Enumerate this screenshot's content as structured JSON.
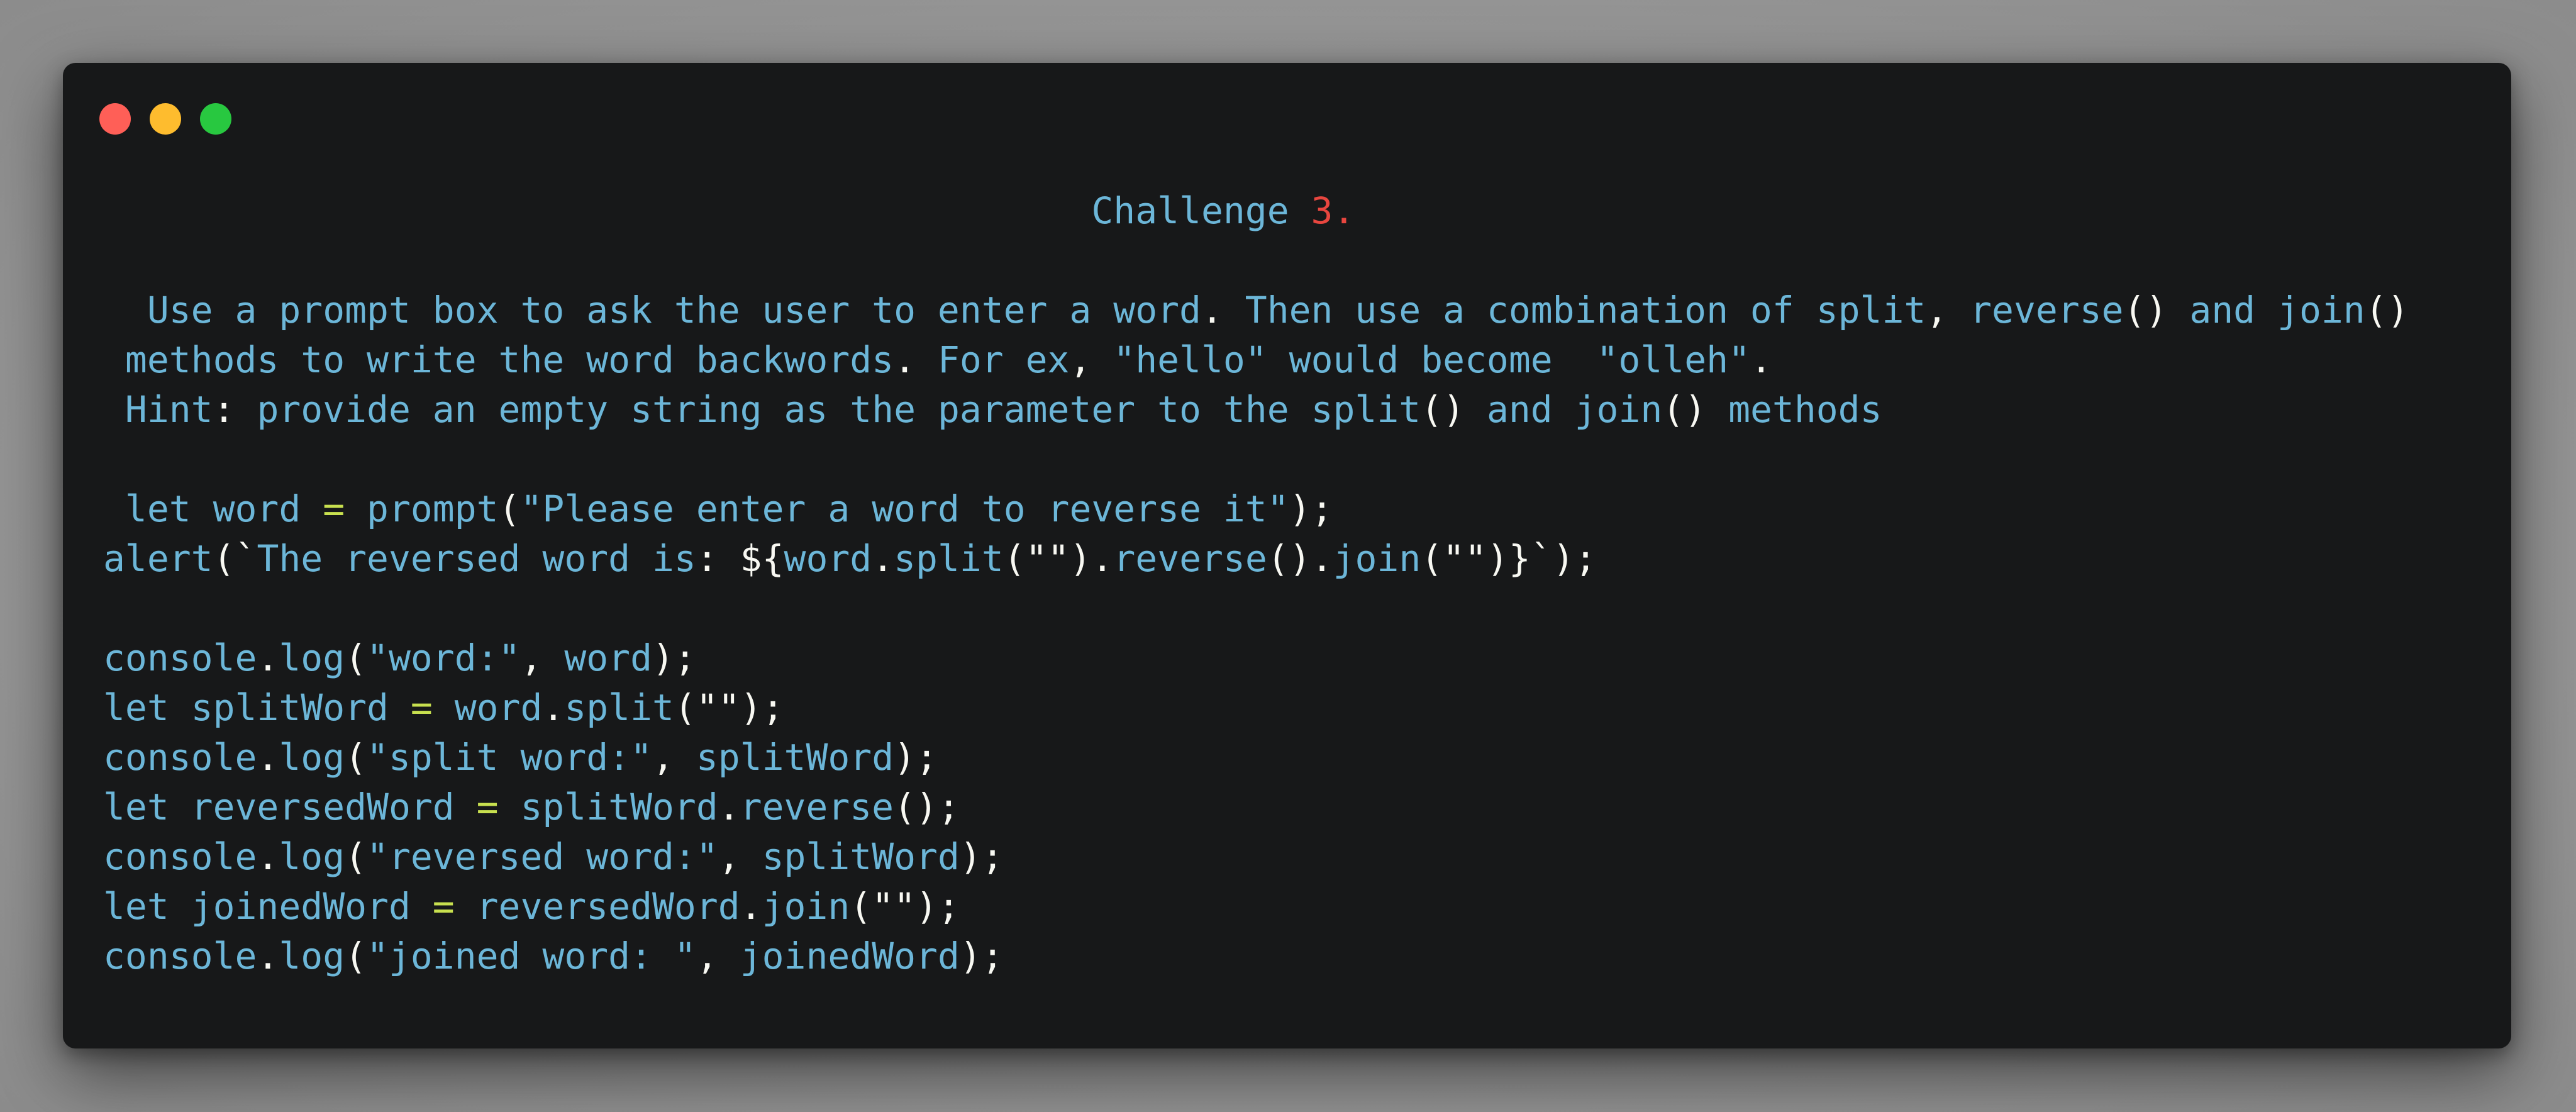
{
  "window": {
    "controls": [
      {
        "name": "close",
        "color": "#ff5f57"
      },
      {
        "name": "minimize",
        "color": "#febc2e"
      },
      {
        "name": "maximize",
        "color": "#28c840"
      }
    ]
  },
  "colors": {
    "background": "#171819",
    "text": "#6cb6d8",
    "number": "#e8463f",
    "punctuation": "#f8f8f2",
    "operator": "#c8e04f"
  },
  "code": {
    "lines": [
      [
        {
          "t": "                                             Challenge ",
          "c": "c"
        },
        {
          "t": "3.",
          "c": "n"
        }
      ],
      [],
      [
        {
          "t": "  Use a prompt box to ask the user to enter a word",
          "c": "c"
        },
        {
          "t": ". ",
          "c": "p"
        },
        {
          "t": "Then use a combination of split",
          "c": "c"
        },
        {
          "t": ", ",
          "c": "p"
        },
        {
          "t": "reverse",
          "c": "c"
        },
        {
          "t": "() ",
          "c": "p"
        },
        {
          "t": "and join",
          "c": "c"
        },
        {
          "t": "()",
          "c": "p"
        }
      ],
      [
        {
          "t": " methods to write the word backwords",
          "c": "c"
        },
        {
          "t": ". ",
          "c": "p"
        },
        {
          "t": "For ex",
          "c": "c"
        },
        {
          "t": ", ",
          "c": "p"
        },
        {
          "t": "\"hello\" would become  \"olleh\"",
          "c": "c"
        },
        {
          "t": ".",
          "c": "p"
        }
      ],
      [
        {
          "t": " Hint",
          "c": "c"
        },
        {
          "t": ": ",
          "c": "p"
        },
        {
          "t": "provide an empty string as the parameter to the split",
          "c": "c"
        },
        {
          "t": "() ",
          "c": "p"
        },
        {
          "t": "and join",
          "c": "c"
        },
        {
          "t": "() ",
          "c": "p"
        },
        {
          "t": "methods",
          "c": "c"
        }
      ],
      [],
      [
        {
          "t": " let word ",
          "c": "k"
        },
        {
          "t": "= ",
          "c": "o"
        },
        {
          "t": "prompt",
          "c": "c"
        },
        {
          "t": "(",
          "c": "p"
        },
        {
          "t": "\"Please enter a word to reverse it\"",
          "c": "s"
        },
        {
          "t": ");",
          "c": "p"
        }
      ],
      [
        {
          "t": "alert",
          "c": "c"
        },
        {
          "t": "(`",
          "c": "p"
        },
        {
          "t": "The reversed word is",
          "c": "s"
        },
        {
          "t": ": ${",
          "c": "p"
        },
        {
          "t": "word",
          "c": "c"
        },
        {
          "t": ".",
          "c": "p"
        },
        {
          "t": "split",
          "c": "c"
        },
        {
          "t": "(\"\").",
          "c": "p"
        },
        {
          "t": "reverse",
          "c": "c"
        },
        {
          "t": "().",
          "c": "p"
        },
        {
          "t": "join",
          "c": "c"
        },
        {
          "t": "(\"\")}`);",
          "c": "p"
        }
      ],
      [],
      [
        {
          "t": "console",
          "c": "c"
        },
        {
          "t": ".",
          "c": "p"
        },
        {
          "t": "log",
          "c": "c"
        },
        {
          "t": "(",
          "c": "p"
        },
        {
          "t": "\"word:\"",
          "c": "s"
        },
        {
          "t": ", ",
          "c": "p"
        },
        {
          "t": "word",
          "c": "c"
        },
        {
          "t": ");",
          "c": "p"
        }
      ],
      [
        {
          "t": "let splitWord ",
          "c": "k"
        },
        {
          "t": "= ",
          "c": "o"
        },
        {
          "t": "word",
          "c": "c"
        },
        {
          "t": ".",
          "c": "p"
        },
        {
          "t": "split",
          "c": "c"
        },
        {
          "t": "(\"\");",
          "c": "p"
        }
      ],
      [
        {
          "t": "console",
          "c": "c"
        },
        {
          "t": ".",
          "c": "p"
        },
        {
          "t": "log",
          "c": "c"
        },
        {
          "t": "(",
          "c": "p"
        },
        {
          "t": "\"split word:\"",
          "c": "s"
        },
        {
          "t": ", ",
          "c": "p"
        },
        {
          "t": "splitWord",
          "c": "c"
        },
        {
          "t": ");",
          "c": "p"
        }
      ],
      [
        {
          "t": "let reversedWord ",
          "c": "k"
        },
        {
          "t": "= ",
          "c": "o"
        },
        {
          "t": "splitWord",
          "c": "c"
        },
        {
          "t": ".",
          "c": "p"
        },
        {
          "t": "reverse",
          "c": "c"
        },
        {
          "t": "();",
          "c": "p"
        }
      ],
      [
        {
          "t": "console",
          "c": "c"
        },
        {
          "t": ".",
          "c": "p"
        },
        {
          "t": "log",
          "c": "c"
        },
        {
          "t": "(",
          "c": "p"
        },
        {
          "t": "\"reversed word:\"",
          "c": "s"
        },
        {
          "t": ", ",
          "c": "p"
        },
        {
          "t": "splitWord",
          "c": "c"
        },
        {
          "t": ");",
          "c": "p"
        }
      ],
      [
        {
          "t": "let joinedWord ",
          "c": "k"
        },
        {
          "t": "= ",
          "c": "o"
        },
        {
          "t": "reversedWord",
          "c": "c"
        },
        {
          "t": ".",
          "c": "p"
        },
        {
          "t": "join",
          "c": "c"
        },
        {
          "t": "(\"\");",
          "c": "p"
        }
      ],
      [
        {
          "t": "console",
          "c": "c"
        },
        {
          "t": ".",
          "c": "p"
        },
        {
          "t": "log",
          "c": "c"
        },
        {
          "t": "(",
          "c": "p"
        },
        {
          "t": "\"joined word: \"",
          "c": "s"
        },
        {
          "t": ", ",
          "c": "p"
        },
        {
          "t": "joinedWord",
          "c": "c"
        },
        {
          "t": ");",
          "c": "p"
        }
      ]
    ]
  }
}
